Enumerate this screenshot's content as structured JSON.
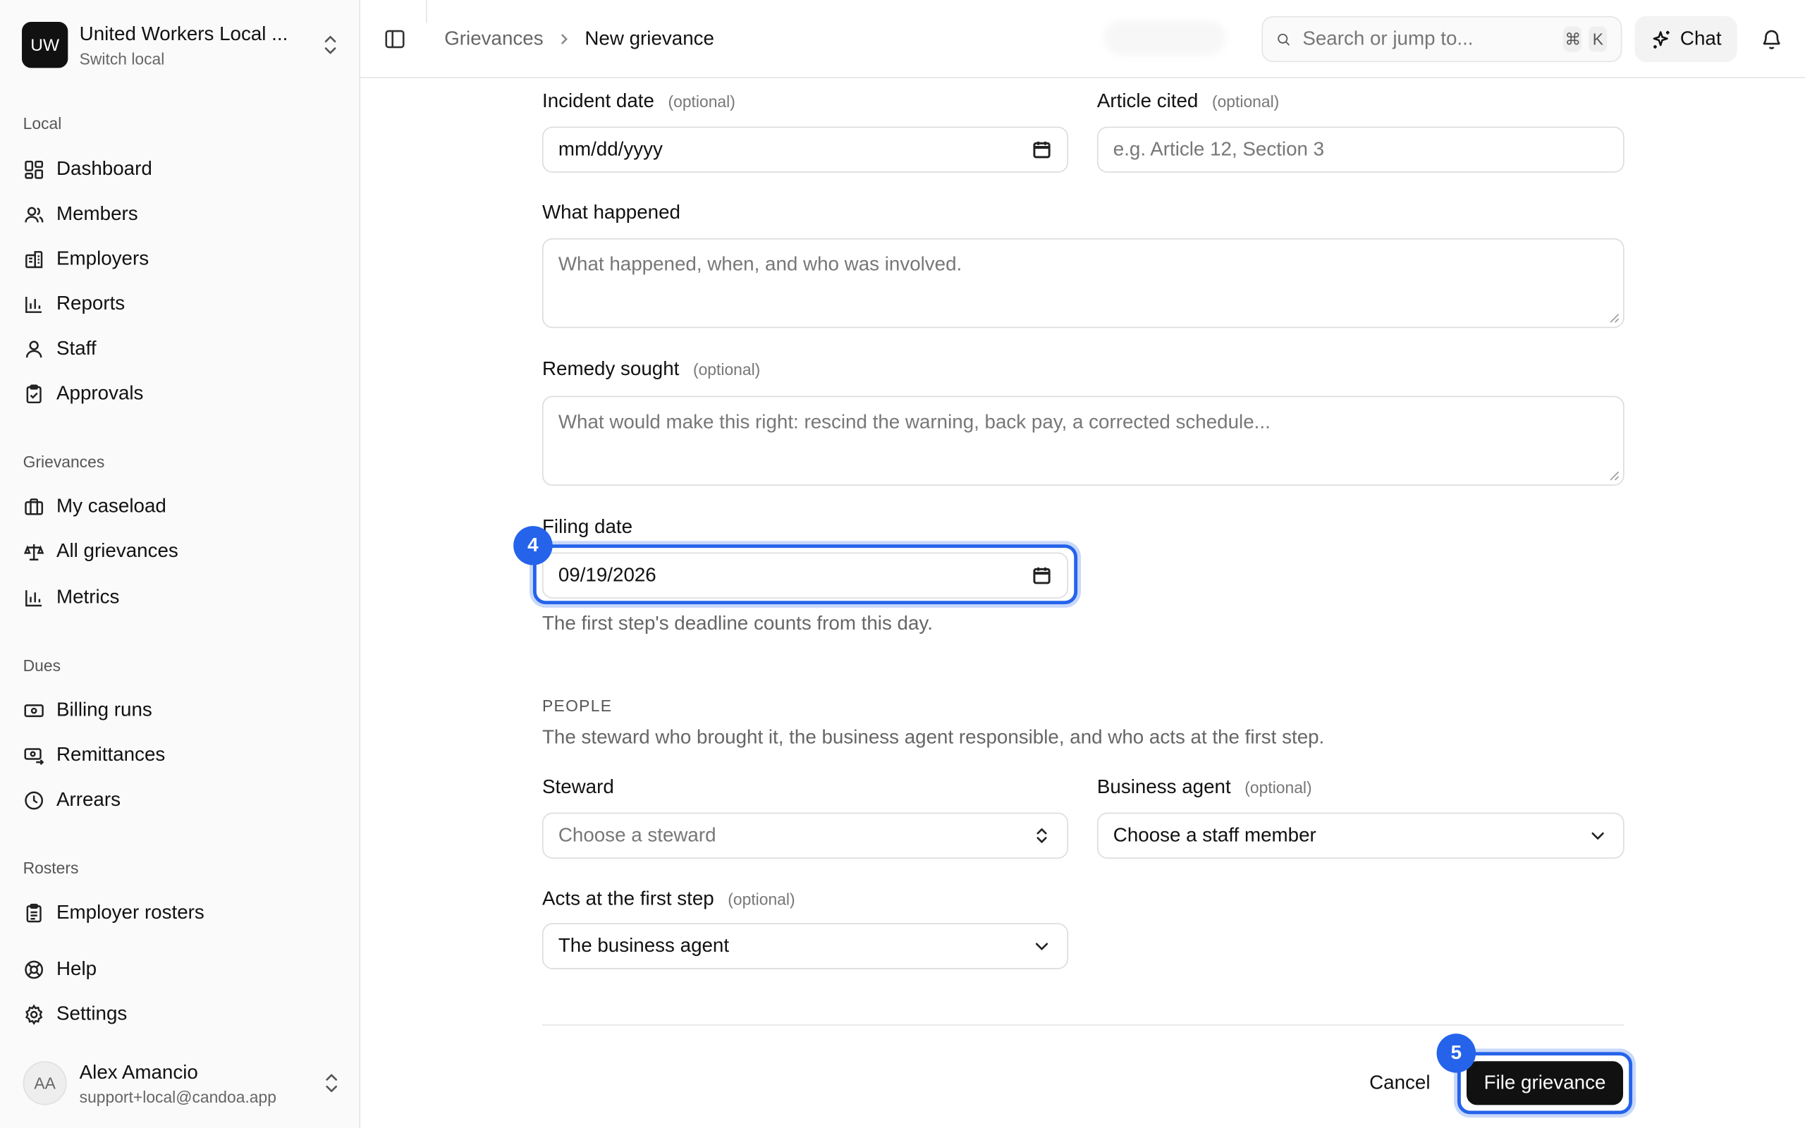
{
  "org": {
    "avatar": "UW",
    "name": "United Workers Local ...",
    "sub": "Switch local"
  },
  "nav": {
    "local_label": "Local",
    "local_items": [
      "Dashboard",
      "Members",
      "Employers",
      "Reports",
      "Staff",
      "Approvals"
    ],
    "grievances_label": "Grievances",
    "grievances_items": [
      "My caseload",
      "All grievances",
      "Metrics"
    ],
    "dues_label": "Dues",
    "dues_items": [
      "Billing runs",
      "Remittances",
      "Arrears"
    ],
    "rosters_label": "Rosters",
    "rosters_items": [
      "Employer rosters"
    ],
    "help": "Help",
    "settings": "Settings"
  },
  "user": {
    "initials": "AA",
    "name": "Alex Amancio",
    "email": "support+local@candoa.app"
  },
  "header": {
    "breadcrumb_parent": "Grievances",
    "breadcrumb_current": "New grievance",
    "search_placeholder": "Search or jump to...",
    "kbd_1": "⌘",
    "kbd_2": "K",
    "chat_label": "Chat"
  },
  "form": {
    "incident_date_label": "Incident date",
    "incident_date_value": "mm/dd/yyyy",
    "article_label": "Article cited",
    "article_placeholder": "e.g. Article 12, Section 3",
    "optional": "(optional)",
    "what_happened_label": "What happened",
    "what_happened_placeholder": "What happened, when, and who was involved.",
    "remedy_label": "Remedy sought",
    "remedy_placeholder": "What would make this right: rescind the warning, back pay, a corrected schedule...",
    "filing_date_label": "Filing date",
    "filing_date_value": "09/19/2026",
    "filing_help": "The first step's deadline counts from this day.",
    "people_title": "PEOPLE",
    "people_desc": "The steward who brought it, the business agent responsible, and who acts at the first step.",
    "steward_label": "Steward",
    "steward_placeholder": "Choose a steward",
    "agent_label": "Business agent",
    "agent_value": "Choose a staff member",
    "first_step_label": "Acts at the first step",
    "first_step_value": "The business agent",
    "cancel": "Cancel",
    "submit": "File grievance"
  },
  "annotations": {
    "badge_filing": "4",
    "badge_submit": "5",
    "accent": "#2563eb"
  }
}
